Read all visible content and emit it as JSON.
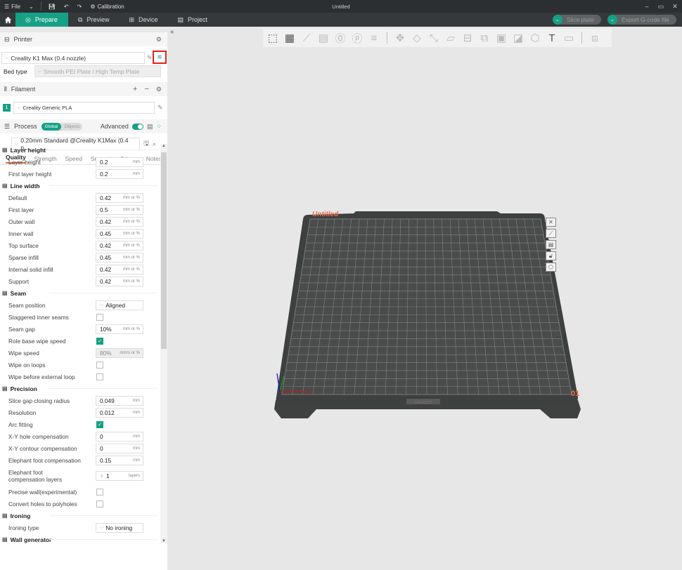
{
  "titlebar": {
    "menu_label": "File",
    "calibration_label": "Calibration",
    "window_title": "Untitled"
  },
  "nav": {
    "tabs": [
      {
        "label": "Prepare",
        "active": true
      },
      {
        "label": "Preview",
        "active": false
      },
      {
        "label": "Device",
        "active": false
      },
      {
        "label": "Project",
        "active": false
      }
    ],
    "slice_label": "Slice plate",
    "export_label": "Export G-code file"
  },
  "printer": {
    "section_label": "Printer",
    "selected": "Creality K1 Max (0.4 nozzle)",
    "bed_type_label": "Bed type",
    "bed_type_value": "Smooth PEI Plate / High Temp Plate"
  },
  "filament": {
    "section_label": "Filament",
    "slot_number": "1",
    "selected": "Creality Generic PLA"
  },
  "process": {
    "section_label": "Process",
    "toggle_global": "Global",
    "toggle_objects": "Objects",
    "advanced_label": "Advanced",
    "advanced_on": true,
    "preset": "0.20mm Standard @Creality K1Max (0.4 n...",
    "subtabs": [
      "Quality",
      "Strength",
      "Speed",
      "Support",
      "Others",
      "Notes"
    ],
    "active_subtab": "Quality"
  },
  "params": [
    {
      "type": "group",
      "label": "Layer height",
      "icon": "layers-icon"
    },
    {
      "type": "field",
      "label": "Layer height",
      "value": "0.2",
      "unit": "mm"
    },
    {
      "type": "field",
      "label": "First layer height",
      "value": "0.2",
      "unit": "mm"
    },
    {
      "type": "group",
      "label": "Line width",
      "icon": "line-width-icon"
    },
    {
      "type": "field",
      "label": "Default",
      "value": "0.42",
      "unit": "mm or %"
    },
    {
      "type": "field",
      "label": "First layer",
      "value": "0.5",
      "unit": "mm or %"
    },
    {
      "type": "field",
      "label": "Outer wall",
      "value": "0.42",
      "unit": "mm or %"
    },
    {
      "type": "field",
      "label": "Inner wall",
      "value": "0.45",
      "unit": "mm or %"
    },
    {
      "type": "field",
      "label": "Top surface",
      "value": "0.42",
      "unit": "mm or %"
    },
    {
      "type": "field",
      "label": "Sparse infill",
      "value": "0.45",
      "unit": "mm or %"
    },
    {
      "type": "field",
      "label": "Internal solid infill",
      "value": "0.42",
      "unit": "mm or %"
    },
    {
      "type": "field",
      "label": "Support",
      "value": "0.42",
      "unit": "mm or %"
    },
    {
      "type": "group",
      "label": "Seam",
      "icon": "seam-icon"
    },
    {
      "type": "select",
      "label": "Seam position",
      "value": "Aligned"
    },
    {
      "type": "check",
      "label": "Staggered inner seams",
      "checked": false
    },
    {
      "type": "field",
      "label": "Seam gap",
      "value": "10%",
      "unit": "mm or %"
    },
    {
      "type": "check",
      "label": "Role base wipe speed",
      "checked": true
    },
    {
      "type": "field",
      "label": "Wipe speed",
      "value": "80%",
      "unit": "mm/s or %",
      "disabled": true
    },
    {
      "type": "check",
      "label": "Wipe on loops",
      "checked": false
    },
    {
      "type": "check",
      "label": "Wipe before external loop",
      "checked": false
    },
    {
      "type": "group",
      "label": "Precision",
      "icon": "precision-icon"
    },
    {
      "type": "field",
      "label": "Slice gap closing radius",
      "value": "0.049",
      "unit": "mm"
    },
    {
      "type": "field",
      "label": "Resolution",
      "value": "0.012",
      "unit": "mm"
    },
    {
      "type": "check",
      "label": "Arc fitting",
      "checked": true
    },
    {
      "type": "field",
      "label": "X-Y hole compensation",
      "value": "0",
      "unit": "mm"
    },
    {
      "type": "field",
      "label": "X-Y contour compensation",
      "value": "0",
      "unit": "mm"
    },
    {
      "type": "field",
      "label": "Elephant foot compensation",
      "value": "0.15",
      "unit": "mm"
    },
    {
      "type": "spin",
      "label": "Elephant foot compensation layers",
      "value": "1",
      "unit": "layers"
    },
    {
      "type": "check",
      "label": "Precise wall(experimental)",
      "checked": false
    },
    {
      "type": "check",
      "label": "Convert holes to polyholes",
      "checked": false
    },
    {
      "type": "group",
      "label": "Ironing",
      "icon": "ironing-icon"
    },
    {
      "type": "select",
      "label": "Ironing type",
      "value": "No ironing"
    },
    {
      "type": "group",
      "label": "Wall generator",
      "icon": "wall-generator-icon"
    }
  ],
  "canvas": {
    "plate_name": "Untitled",
    "plate_number": "01",
    "bed_brand": "CREALITY",
    "toolbar": [
      "add-object",
      "add-plate",
      "auto-orient",
      "arrange",
      "add-plate-0",
      "add-plate-p",
      "layers",
      "move",
      "rotate",
      "scale",
      "lay-on-face",
      "cut",
      "boolean",
      "support-paint",
      "seam-paint",
      "mmu-paint",
      "text",
      "measure",
      "assembly"
    ],
    "plate_buttons": [
      "delete-plate",
      "orient-plate",
      "arrange-plate",
      "lock-plate",
      "plate-settings"
    ]
  },
  "colors": {
    "accent": "#16a085",
    "highlight_box": "#e02020",
    "plate_label": "#e8704a"
  }
}
